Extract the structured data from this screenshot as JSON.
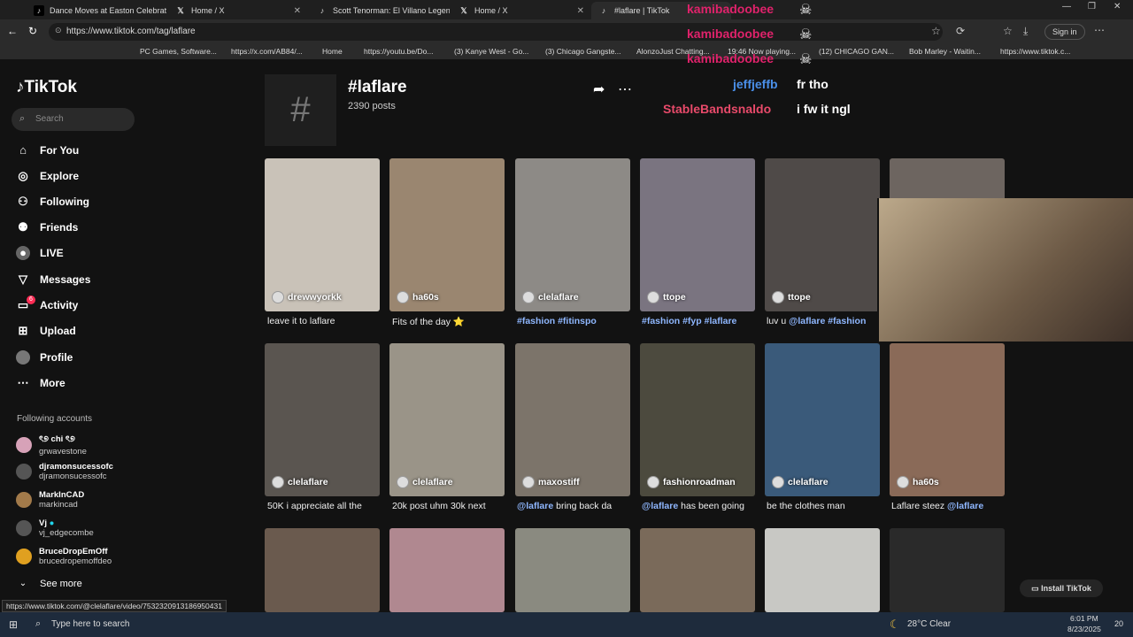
{
  "tabs": [
    {
      "title": "Dance Moves at Easton Celebrati"
    },
    {
      "title": "Home / X"
    },
    {
      "title": "Scott Tenorman: El Villano Legen"
    },
    {
      "title": "Home / X"
    },
    {
      "title": "#laflare | TikTok"
    }
  ],
  "address_bar": {
    "url": "https://www.tiktok.com/tag/laflare",
    "signin": "Sign in"
  },
  "bookmarks": [
    "PC Games, Software...",
    "https://x.com/AB84/...",
    "Home",
    "https://youtu.be/Do...",
    "(3) Kanye West - Go...",
    "(3) Chicago Gangste...",
    "AlonzoJust Chatting...",
    "19:46 Now playing...",
    "(12) CHICAGO GAN...",
    "Bob Marley - Waitin...",
    "https://www.tiktok.c..."
  ],
  "sidebar": {
    "logo": "TikTok",
    "search_placeholder": "Search",
    "nav": [
      {
        "label": "For You",
        "icon": "home-icon"
      },
      {
        "label": "Explore",
        "icon": "compass-icon"
      },
      {
        "label": "Following",
        "icon": "following-icon"
      },
      {
        "label": "Friends",
        "icon": "friends-icon"
      },
      {
        "label": "LIVE",
        "icon": "live-icon"
      },
      {
        "label": "Messages",
        "icon": "messages-icon"
      },
      {
        "label": "Activity",
        "icon": "activity-icon",
        "badge": "6"
      },
      {
        "label": "Upload",
        "icon": "upload-icon"
      },
      {
        "label": "Profile",
        "icon": "profile-icon"
      },
      {
        "label": "More",
        "icon": "more-icon"
      }
    ],
    "following_title": "Following accounts",
    "accounts": [
      {
        "name": "ৎ୭ chi ৎ୭",
        "handle": "grwavestone"
      },
      {
        "name": "djramonsucessofc",
        "handle": "djramonsucessofc"
      },
      {
        "name": "MarkInCAD",
        "handle": "markincad"
      },
      {
        "name": "Vj",
        "handle": "vj_edgecombe"
      },
      {
        "name": "BruceDropEmOff",
        "handle": "brucedropemoffdeo"
      }
    ],
    "see_more": "See more"
  },
  "tag": {
    "title": "#laflare",
    "posts": "2390 posts",
    "hash_glyph": "#"
  },
  "chat": [
    {
      "user": "kamibadoobee",
      "msg": "",
      "color": "#e0226b"
    },
    {
      "user": "kamibadoobee",
      "msg": "",
      "color": "#e0226b"
    },
    {
      "user": "kamibadoobee",
      "msg": "",
      "color": "#e0226b"
    },
    {
      "user": "jeffjeffb",
      "msg": "fr tho",
      "color": "#4a8fe8"
    },
    {
      "user": "StableBandsnaldo",
      "msg": "i fw it ngl",
      "color": "#e84a6a"
    }
  ],
  "row1": [
    {
      "user": "drewwyorkk",
      "caption_text": "leave it to laflare",
      "caption_tag": "",
      "bg": "#c9c2b8"
    },
    {
      "user": "ha60s",
      "caption_text": "Fits of the day ⭐",
      "caption_tag": "",
      "bg": "#9a8670"
    },
    {
      "user": "clelaflare",
      "caption_text": "",
      "caption_tag": "#fashion #fitinspo",
      "bg": "#8d8a86"
    },
    {
      "user": "ttope",
      "caption_text": "",
      "caption_tag": "#fashion #fyp #laflare",
      "bg": "#7a7480"
    },
    {
      "user": "ttope",
      "caption_text": "luv u ",
      "caption_tag": "@laflare #fashion",
      "bg": "#4f4a48"
    },
    {
      "user": "",
      "caption_text": "",
      "caption_tag": "",
      "bg": "#6d6560"
    }
  ],
  "row2": [
    {
      "user": "clelaflare",
      "caption_text": "50K i appreciate all the",
      "caption_tag": "",
      "bg": "#5a5550"
    },
    {
      "user": "clelaflare",
      "caption_text": "20k post uhm 30k next",
      "caption_tag": "",
      "bg": "#9a9488"
    },
    {
      "user": "maxostiff",
      "caption_text": " bring back da",
      "caption_tag": "@laflare",
      "bg": "#7c746a"
    },
    {
      "user": "fashionroadman",
      "caption_text": " has been going",
      "caption_tag": "@laflare",
      "bg": "#4c4a3e"
    },
    {
      "user": "clelaflare",
      "caption_text": "be the clothes man",
      "caption_tag": "",
      "bg": "#3a5a7a"
    },
    {
      "user": "ha60s",
      "caption_text": "Laflare steez ",
      "caption_tag": "@laflare",
      "bg": "#8a6a58"
    }
  ],
  "row3_bgs": [
    "#6a5a4e",
    "#b08890",
    "#8a8a80",
    "#7a6a5a",
    "#c8c8c4",
    "#2a2a2a"
  ],
  "install": "Install TikTok",
  "status_link": "https://www.tiktok.com/@clelaflare/video/7532320913186950431",
  "taskbar": {
    "search": "Type here to search",
    "weather": "28°C  Clear",
    "time": "6:01 PM",
    "date": "8/23/2025",
    "notif": "20"
  }
}
